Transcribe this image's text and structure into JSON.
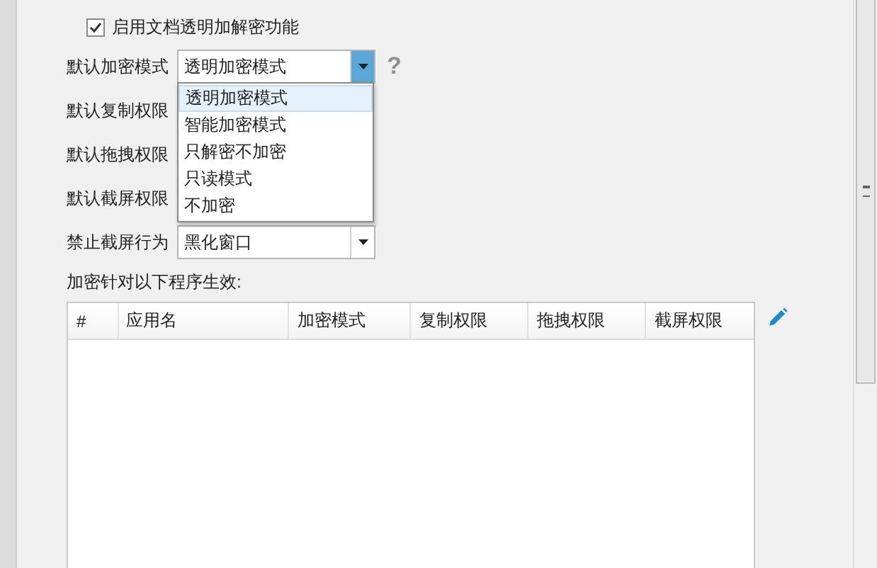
{
  "enable_checkbox": {
    "label": "启用文档透明加解密功能",
    "checked": true
  },
  "settings": [
    {
      "label": "默认加密模式",
      "value": "透明加密模式",
      "expanded": true,
      "help": "?"
    },
    {
      "label": "默认复制权限"
    },
    {
      "label": "默认拖拽权限"
    },
    {
      "label": "默认截屏权限"
    },
    {
      "label": "禁止截屏行为",
      "value": "黑化窗口",
      "expanded": false
    }
  ],
  "dropdown_options": [
    {
      "label": "透明加密模式",
      "selected": true
    },
    {
      "label": "智能加密模式",
      "selected": false
    },
    {
      "label": "只解密不加密",
      "selected": false
    },
    {
      "label": "只读模式",
      "selected": false
    },
    {
      "label": "不加密",
      "selected": false
    }
  ],
  "table_caption": "加密针对以下程序生效:",
  "table": {
    "columns": [
      "#",
      "应用名",
      "加密模式",
      "复制权限",
      "拖拽权限",
      "截屏权限"
    ]
  }
}
